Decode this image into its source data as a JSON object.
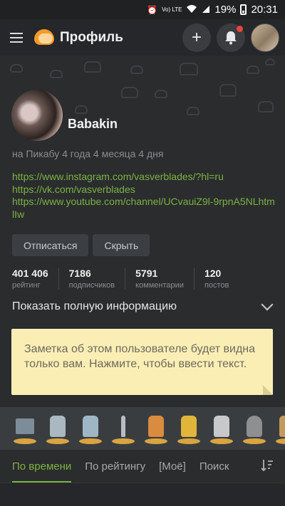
{
  "status_bar": {
    "battery": "19%",
    "time": "20:31",
    "network": "Vo) LTE"
  },
  "header": {
    "title": "Профиль",
    "icons": [
      "menu-icon",
      "pikabu-logo",
      "plus-icon",
      "bell-icon",
      "avatar"
    ],
    "notification_dot_color": "#e8453c"
  },
  "profile": {
    "username": "Babakin",
    "since": "на Пикабу 4 года 4 месяца 4 дня",
    "links": [
      "https://www.instagram.com/vasverblades/?hl=ru",
      "https://vk.com/vasverblades",
      "https://www.youtube.com/channel/UCvauiZ9l-9rpnA5NLhtmlIw"
    ],
    "buttons": {
      "unsubscribe": "Отписаться",
      "hide": "Скрыть"
    },
    "stats": [
      {
        "value": "401 406",
        "label": "рейтинг"
      },
      {
        "value": "7186",
        "label": "подписчиков"
      },
      {
        "value": "5791",
        "label": "комментарии"
      },
      {
        "value": "120",
        "label": "постов"
      }
    ],
    "show_more": "Показать полную информацию",
    "note": "Заметка об этом пользователе будет видна только вам. Нажмите, чтобы ввести текст."
  },
  "awards": [
    "award-envelopes",
    "award-2020-hands",
    "award-hands-blue",
    "award-broom",
    "award-hands-orange",
    "award-hands-gold",
    "award-thumbs-up",
    "award-bust"
  ],
  "tabs": [
    "По времени",
    "По рейтингу",
    "[Моё]",
    "Поиск"
  ],
  "active_tab": "По времени",
  "colors": {
    "accent_green": "#7cb342",
    "note_bg": "#fbeeb5",
    "background": "#2a2c2e"
  }
}
